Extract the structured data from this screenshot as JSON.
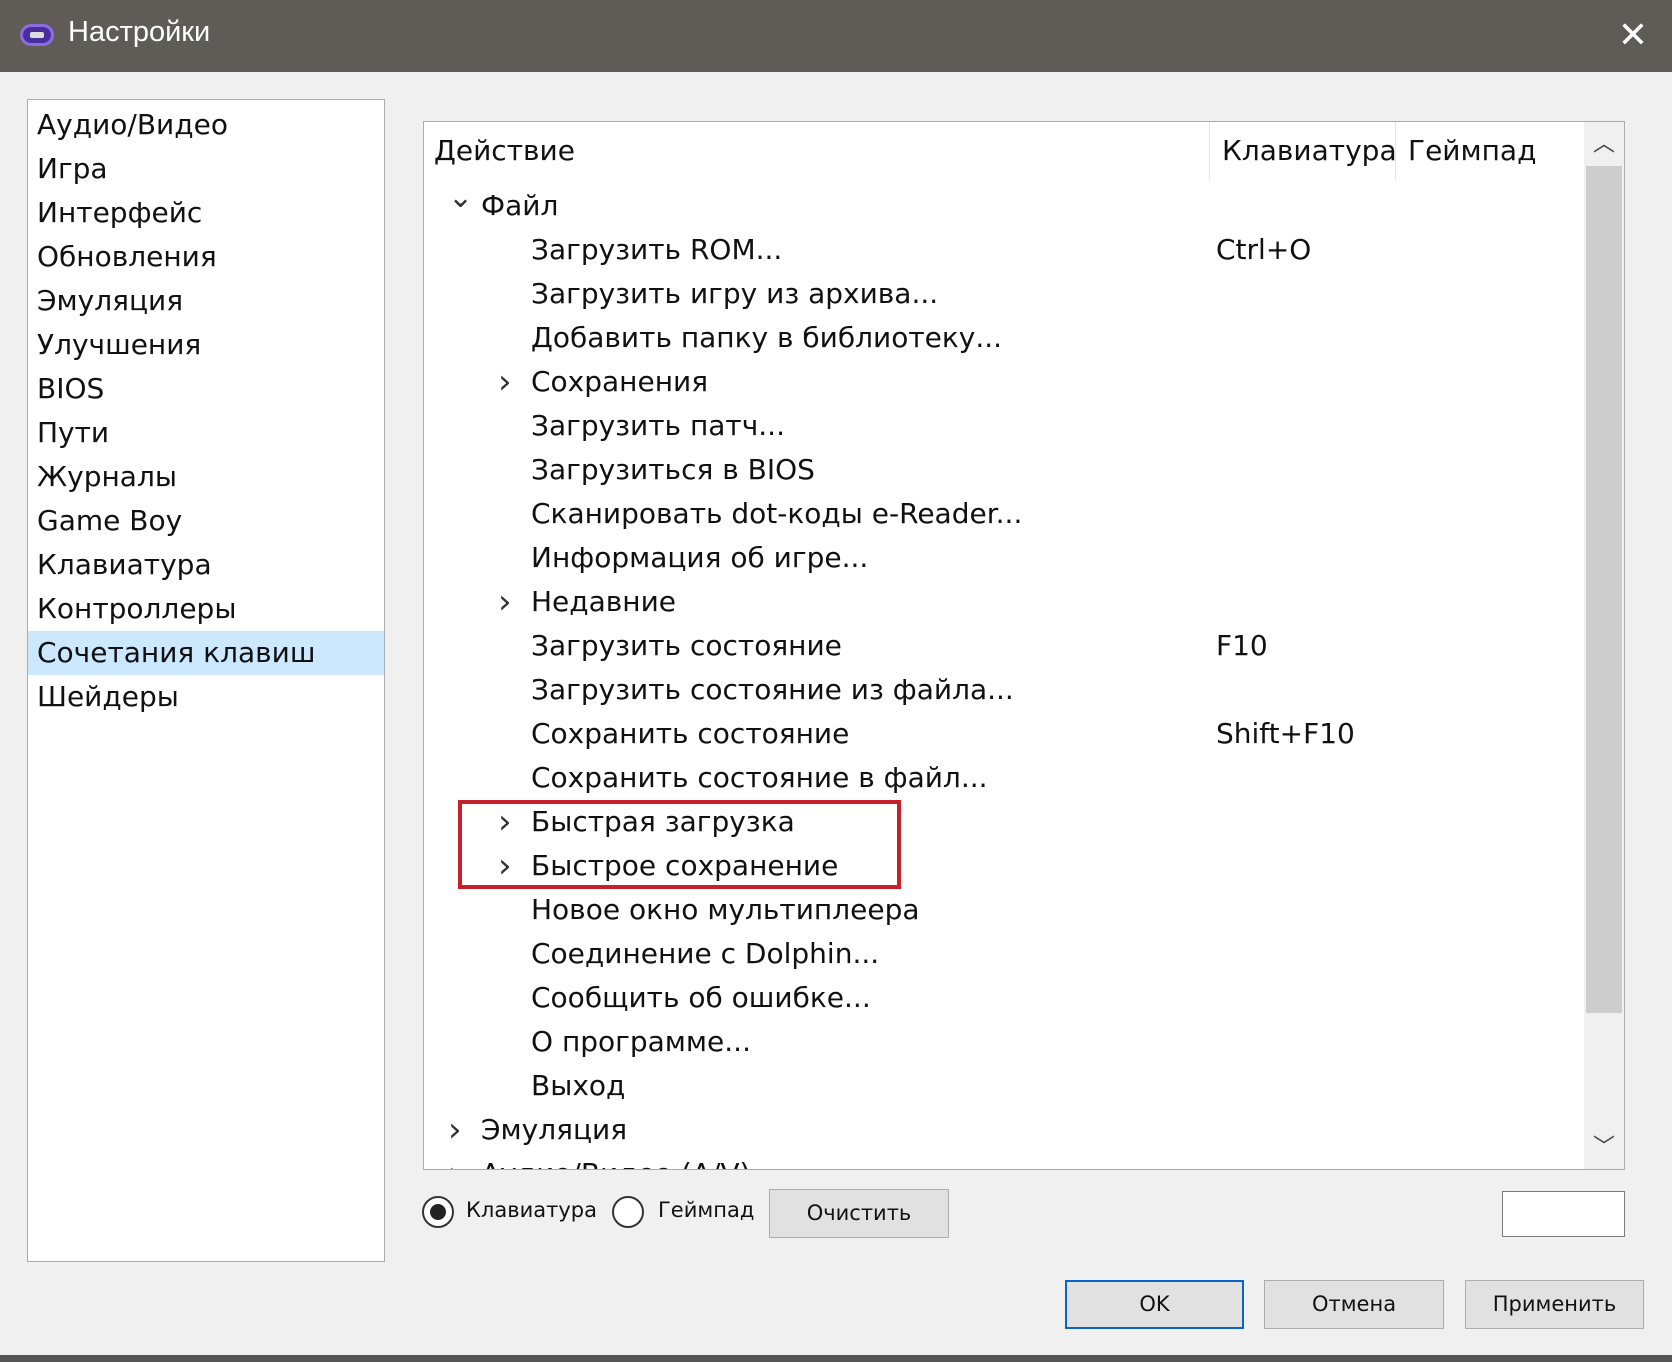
{
  "window": {
    "title": "Настройки",
    "close_icon": "close-icon",
    "app_icon": "gamepad-app-icon"
  },
  "sidebar": {
    "items": [
      "Аудио/Видео",
      "Игра",
      "Интерфейс",
      "Обновления",
      "Эмуляция",
      "Улучшения",
      "BIOS",
      "Пути",
      "Журналы",
      "Game Boy",
      "Клавиатура",
      "Контроллеры",
      "Сочетания клавиш",
      "Шейдеры"
    ],
    "selected": "Сочетания клавиш"
  },
  "tree": {
    "columns": [
      "Действие",
      "Клавиатура",
      "Геймпад"
    ],
    "rows": [
      {
        "level": 0,
        "expander": "expanded",
        "label": "Файл",
        "key": ""
      },
      {
        "level": 1,
        "expander": "none",
        "label": "Загрузить ROM...",
        "key": "Ctrl+O"
      },
      {
        "level": 1,
        "expander": "none",
        "label": "Загрузить игру из архива...",
        "key": ""
      },
      {
        "level": 1,
        "expander": "none",
        "label": "Добавить папку в библиотеку...",
        "key": ""
      },
      {
        "level": 1,
        "expander": "collapsed",
        "label": "Сохранения",
        "key": ""
      },
      {
        "level": 1,
        "expander": "none",
        "label": "Загрузить патч...",
        "key": ""
      },
      {
        "level": 1,
        "expander": "none",
        "label": "Загрузиться в BIOS",
        "key": ""
      },
      {
        "level": 1,
        "expander": "none",
        "label": "Сканировать dot-коды e-Reader...",
        "key": ""
      },
      {
        "level": 1,
        "expander": "none",
        "label": "Информация об игре...",
        "key": ""
      },
      {
        "level": 1,
        "expander": "collapsed",
        "label": "Недавние",
        "key": ""
      },
      {
        "level": 1,
        "expander": "none",
        "label": "Загрузить состояние",
        "key": "F10"
      },
      {
        "level": 1,
        "expander": "none",
        "label": "Загрузить состояние из файла...",
        "key": ""
      },
      {
        "level": 1,
        "expander": "none",
        "label": "Сохранить состояние",
        "key": "Shift+F10"
      },
      {
        "level": 1,
        "expander": "none",
        "label": "Сохранить состояние в файл...",
        "key": ""
      },
      {
        "level": 1,
        "expander": "collapsed",
        "label": "Быстрая загрузка",
        "key": ""
      },
      {
        "level": 1,
        "expander": "collapsed",
        "label": "Быстрое сохранение",
        "key": ""
      },
      {
        "level": 1,
        "expander": "none",
        "label": "Новое окно мультиплеера",
        "key": ""
      },
      {
        "level": 1,
        "expander": "none",
        "label": "Соединение с Dolphin...",
        "key": ""
      },
      {
        "level": 1,
        "expander": "none",
        "label": "Сообщить об ошибке...",
        "key": ""
      },
      {
        "level": 1,
        "expander": "none",
        "label": "О программе...",
        "key": ""
      },
      {
        "level": 1,
        "expander": "none",
        "label": "Выход",
        "key": ""
      },
      {
        "level": 0,
        "expander": "collapsed",
        "label": "Эмуляция",
        "key": ""
      },
      {
        "level": 0,
        "expander": "collapsed",
        "label": "Аудио/Видео (A/V)",
        "key": ""
      }
    ],
    "highlight_color": "#c8202a"
  },
  "controls": {
    "radio_keyboard": "Клавиатура",
    "radio_gamepad": "Геймпад",
    "selected_radio": "Клавиатура",
    "clear": "Очистить",
    "key_input_value": ""
  },
  "footer": {
    "ok": "OK",
    "cancel": "Отмена",
    "apply": "Применить"
  }
}
